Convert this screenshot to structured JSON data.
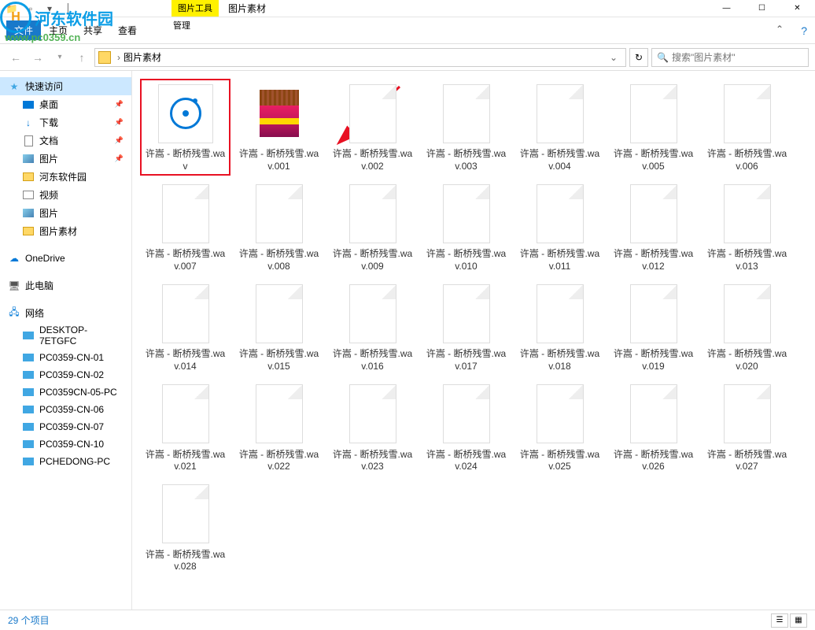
{
  "watermark": {
    "text": "河东软件园",
    "url": "www.pc0359.cn"
  },
  "titlebar": {
    "tab_tool": "图片工具",
    "tab_title": "图片素材",
    "sub_label": "管理"
  },
  "ribbon": {
    "file": "文件",
    "home": "主页",
    "share": "共享",
    "view": "查看"
  },
  "address": {
    "breadcrumb": "图片素材",
    "search_placeholder": "搜索\"图片素材\""
  },
  "sidebar": {
    "quick_access": "快速访问",
    "quick_items": [
      {
        "label": "桌面",
        "icon": "desktop",
        "pinned": true
      },
      {
        "label": "下载",
        "icon": "down",
        "pinned": true
      },
      {
        "label": "文档",
        "icon": "doc",
        "pinned": true
      },
      {
        "label": "图片",
        "icon": "pic",
        "pinned": true
      },
      {
        "label": "河东软件园",
        "icon": "folder",
        "pinned": false
      },
      {
        "label": "视频",
        "icon": "video",
        "pinned": false
      },
      {
        "label": "图片",
        "icon": "pic",
        "pinned": false
      },
      {
        "label": "图片素材",
        "icon": "folder",
        "pinned": false
      }
    ],
    "onedrive": "OneDrive",
    "this_pc": "此电脑",
    "network": "网络",
    "computers": [
      "DESKTOP-7ETGFC",
      "PC0359-CN-01",
      "PC0359-CN-02",
      "PC0359CN-05-PC",
      "PC0359-CN-06",
      "PC0359-CN-07",
      "PC0359-CN-10",
      "PCHEDONG-PC"
    ]
  },
  "files": [
    {
      "name": "许嵩 - 断桥残雪.wav",
      "type": "wav",
      "highlighted": true
    },
    {
      "name": "许嵩 - 断桥残雪.wav.001",
      "type": "rar"
    },
    {
      "name": "许嵩 - 断桥残雪.wav.002",
      "type": "blank"
    },
    {
      "name": "许嵩 - 断桥残雪.wav.003",
      "type": "blank"
    },
    {
      "name": "许嵩 - 断桥残雪.wav.004",
      "type": "blank"
    },
    {
      "name": "许嵩 - 断桥残雪.wav.005",
      "type": "blank"
    },
    {
      "name": "许嵩 - 断桥残雪.wav.006",
      "type": "blank"
    },
    {
      "name": "许嵩 - 断桥残雪.wav.007",
      "type": "blank"
    },
    {
      "name": "许嵩 - 断桥残雪.wav.008",
      "type": "blank"
    },
    {
      "name": "许嵩 - 断桥残雪.wav.009",
      "type": "blank"
    },
    {
      "name": "许嵩 - 断桥残雪.wav.010",
      "type": "blank"
    },
    {
      "name": "许嵩 - 断桥残雪.wav.011",
      "type": "blank"
    },
    {
      "name": "许嵩 - 断桥残雪.wav.012",
      "type": "blank"
    },
    {
      "name": "许嵩 - 断桥残雪.wav.013",
      "type": "blank"
    },
    {
      "name": "许嵩 - 断桥残雪.wav.014",
      "type": "blank"
    },
    {
      "name": "许嵩 - 断桥残雪.wav.015",
      "type": "blank"
    },
    {
      "name": "许嵩 - 断桥残雪.wav.016",
      "type": "blank"
    },
    {
      "name": "许嵩 - 断桥残雪.wav.017",
      "type": "blank"
    },
    {
      "name": "许嵩 - 断桥残雪.wav.018",
      "type": "blank"
    },
    {
      "name": "许嵩 - 断桥残雪.wav.019",
      "type": "blank"
    },
    {
      "name": "许嵩 - 断桥残雪.wav.020",
      "type": "blank"
    },
    {
      "name": "许嵩 - 断桥残雪.wav.021",
      "type": "blank"
    },
    {
      "name": "许嵩 - 断桥残雪.wav.022",
      "type": "blank"
    },
    {
      "name": "许嵩 - 断桥残雪.wav.023",
      "type": "blank"
    },
    {
      "name": "许嵩 - 断桥残雪.wav.024",
      "type": "blank"
    },
    {
      "name": "许嵩 - 断桥残雪.wav.025",
      "type": "blank"
    },
    {
      "name": "许嵩 - 断桥残雪.wav.026",
      "type": "blank"
    },
    {
      "name": "许嵩 - 断桥残雪.wav.027",
      "type": "blank"
    },
    {
      "name": "许嵩 - 断桥残雪.wav.028",
      "type": "blank"
    }
  ],
  "status": {
    "count_text": "29 个项目"
  }
}
